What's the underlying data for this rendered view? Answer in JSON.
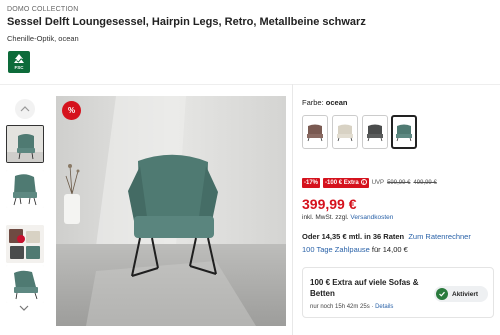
{
  "header": {
    "brand": "DOMO COLLECTION",
    "title": "Sessel Delft Loungesessel, Hairpin Legs, Retro, Metallbeine schwarz",
    "subtitle": "Chenille-Optik, ocean",
    "fsc_label": "FSC"
  },
  "gallery": {
    "discount_badge": "%",
    "thumbnails": [
      "front view",
      "side view",
      "color swatches",
      "angled view"
    ]
  },
  "color": {
    "label": "Farbe: ",
    "selected": "ocean",
    "swatches": [
      {
        "name": "brown",
        "hex": "#7a5a52"
      },
      {
        "name": "cream",
        "hex": "#d8d2c4"
      },
      {
        "name": "anthracite",
        "hex": "#4a4c4c"
      },
      {
        "name": "ocean",
        "hex": "#4f7a72"
      }
    ]
  },
  "pricing": {
    "discount_pct": "-17%",
    "extra_tag": "-100 € Extra",
    "uvp_label": "UVP",
    "uvp_price": "599,99 €",
    "old_price": "499,99 €",
    "price": "399,99 €",
    "tax_text": "inkl. MwSt. zzgl. ",
    "shipping_link": "Versandkosten",
    "rate_text": "Oder 14,35 € mtl. in 36 Raten",
    "rate_link": "Zum Ratenrechner",
    "pause_link": "100 Tage Zahlpause",
    "pause_text": " für 14,00 €"
  },
  "promo": {
    "title": "100 € Extra auf viele Sofas & Betten",
    "timer": "nur noch 15h 42m 25s",
    "separator": " · ",
    "details_link": "Details",
    "toggle_label": "Aktiviert"
  },
  "colors": {
    "accent_red": "#d5121d",
    "link_blue": "#2a62a8",
    "fsc_green": "#0d6b3a",
    "toggle_green": "#2a7a3d"
  }
}
